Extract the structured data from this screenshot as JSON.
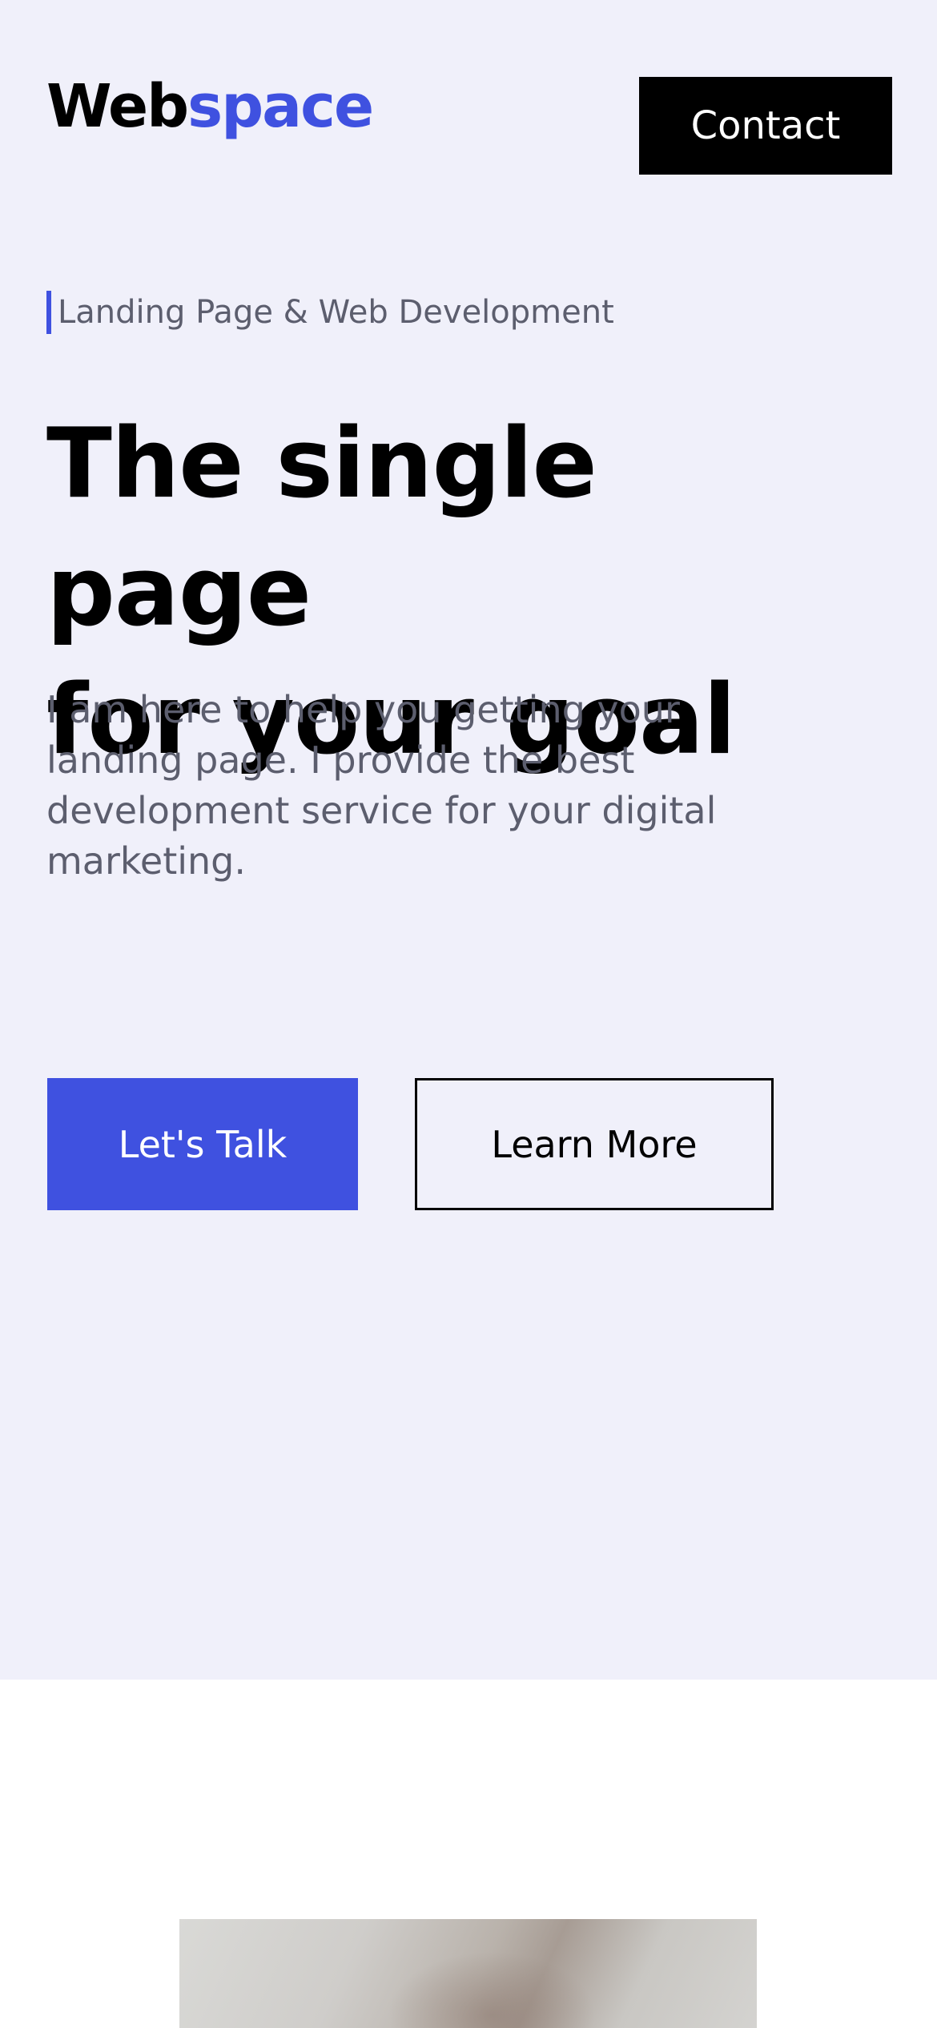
{
  "header": {
    "logo_part1": "Web",
    "logo_part2": "space",
    "contact_label": "Contact"
  },
  "hero": {
    "eyebrow": "Landing Page & Web Development",
    "headline_line1": "The single page",
    "headline_line2": "for your goal",
    "subtext": "I am here to help you getting your landing page. I provide the best development service for your digital marketing.",
    "primary_cta": "Let's Talk",
    "secondary_cta": "Learn More"
  },
  "colors": {
    "accent": "#3f51e0",
    "hero_background": "#f0f0fa",
    "text_primary": "#000000",
    "text_muted": "#5c5e6e"
  }
}
